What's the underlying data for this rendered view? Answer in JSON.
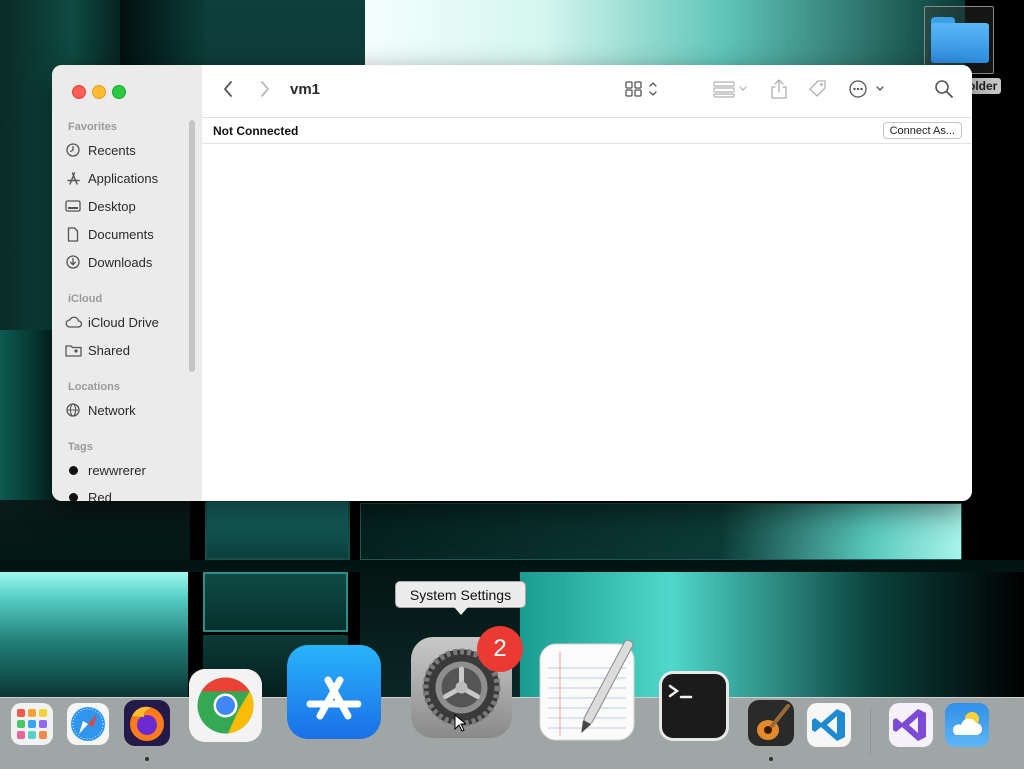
{
  "desktop": {
    "folder_label": "older"
  },
  "finder": {
    "title": "vm1",
    "status": "Not Connected",
    "connect_button": "Connect As...",
    "sidebar": {
      "sections": [
        {
          "header": "Favorites",
          "items": [
            {
              "label": "Recents",
              "icon": "clock-icon"
            },
            {
              "label": "Applications",
              "icon": "applications-icon"
            },
            {
              "label": "Desktop",
              "icon": "desktop-icon"
            },
            {
              "label": "Documents",
              "icon": "document-icon"
            },
            {
              "label": "Downloads",
              "icon": "download-icon"
            }
          ]
        },
        {
          "header": "iCloud",
          "items": [
            {
              "label": "iCloud Drive",
              "icon": "cloud-icon"
            },
            {
              "label": "Shared",
              "icon": "shared-folder-icon"
            }
          ]
        },
        {
          "header": "Locations",
          "items": [
            {
              "label": "Network",
              "icon": "globe-icon"
            }
          ]
        },
        {
          "header": "Tags",
          "items": [
            {
              "label": "rewwrerer",
              "icon": "tag-dot-icon"
            },
            {
              "label": "Red",
              "icon": "tag-dot-icon"
            }
          ]
        }
      ]
    }
  },
  "tooltip": {
    "text": "System Settings"
  },
  "dock": {
    "badge_count": "2",
    "apps": [
      {
        "name": "Launchpad"
      },
      {
        "name": "Safari"
      },
      {
        "name": "Firefox"
      },
      {
        "name": "Google Chrome"
      },
      {
        "name": "App Store"
      },
      {
        "name": "System Settings"
      },
      {
        "name": "TextEdit"
      },
      {
        "name": "Terminal"
      },
      {
        "name": "GarageBand"
      },
      {
        "name": "Visual Studio Code"
      },
      {
        "name": "Visual Studio"
      },
      {
        "name": "Weather"
      }
    ]
  },
  "colors": {
    "close": "#ff5f57",
    "minimize": "#febc2e",
    "zoom": "#28c840",
    "badge": "#ea3a33"
  }
}
